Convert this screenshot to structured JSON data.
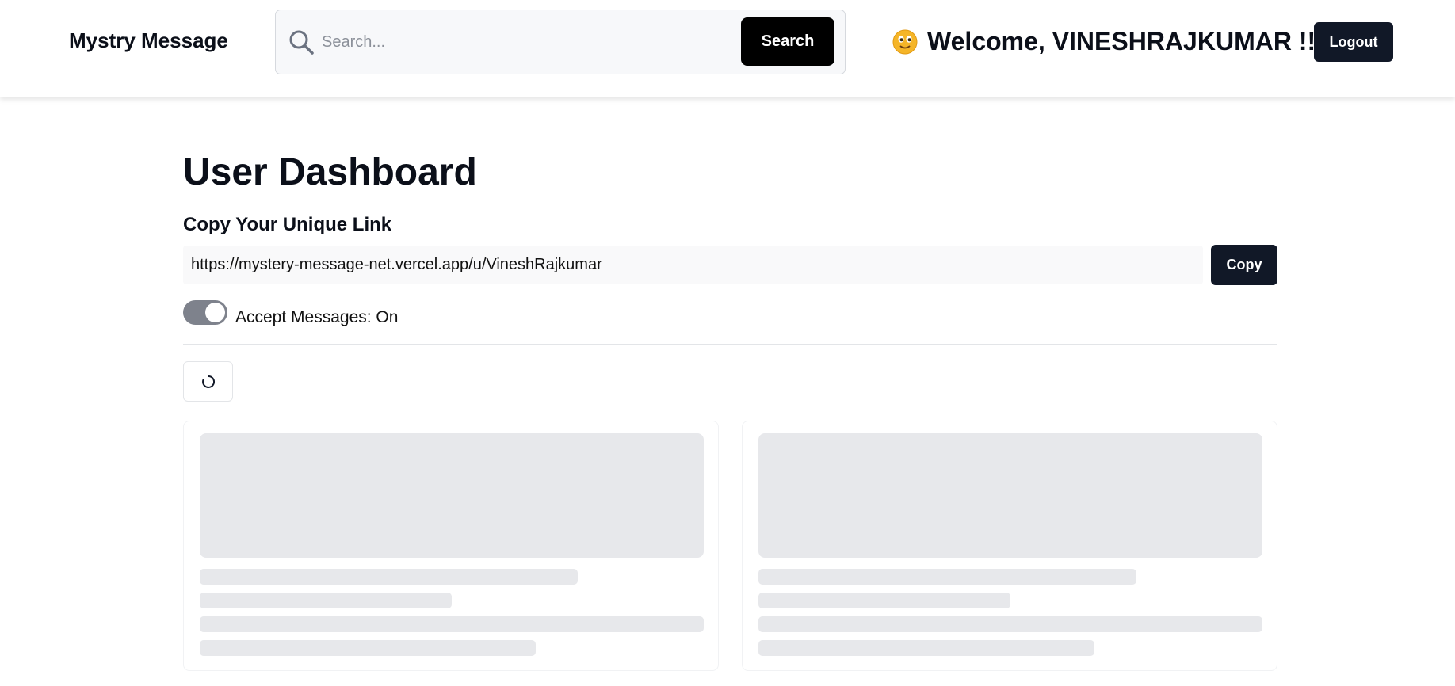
{
  "header": {
    "brand": "Mystry Message",
    "search": {
      "placeholder": "Search...",
      "value": "",
      "button_label": "Search"
    },
    "welcome_text": "Welcome, VINESHRAJKUMAR !!",
    "welcome_icon": "smiley-face-icon",
    "logout_label": "Logout"
  },
  "main": {
    "title": "User Dashboard",
    "link_section": {
      "heading": "Copy Your Unique Link",
      "url": "https://mystery-message-net.vercel.app/u/VineshRajkumar",
      "copy_label": "Copy"
    },
    "accept_messages": {
      "label": "Accept Messages: On",
      "enabled": true
    },
    "refresh_icon": "loading-spinner-icon",
    "message_cards_loading": 2
  },
  "colors": {
    "primary_dark": "#111827",
    "search_button": "#000000",
    "skeleton": "#e7e8eb",
    "toggle_track": "#7e828c"
  }
}
